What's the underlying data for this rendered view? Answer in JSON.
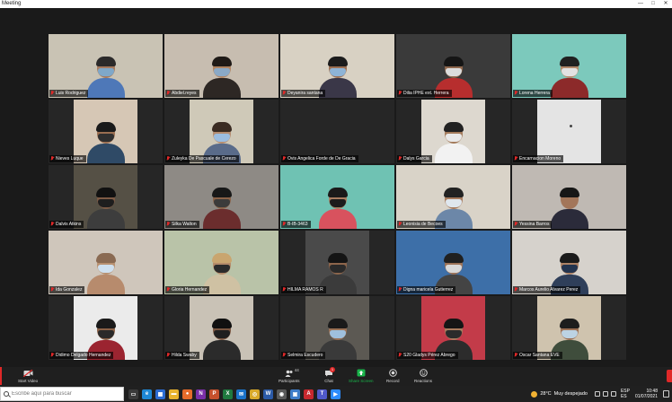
{
  "window": {
    "title": "Meeting",
    "controls": {
      "minimize": "—",
      "maximize": "□",
      "close": "✕"
    }
  },
  "participants": [
    {
      "name": "Luis Rodriguez",
      "bg": "#c9c3b4",
      "scene": "full",
      "skin": "#a67a5e",
      "mask": "#7fa8c9",
      "shirt": "#4e78b8",
      "hair": "#2b2a2a"
    },
    {
      "name": "Abdiel.reyes",
      "bg": "#c7bdb0",
      "scene": "full",
      "skin": "#b08462",
      "mask": "#8aa9c7",
      "shirt": "#2d2724",
      "hair": "#1f1a17"
    },
    {
      "name": "Deyanira santana",
      "bg": "#d8d1c3",
      "scene": "full",
      "skin": "#9c6f52",
      "mask": "#8eb4d6",
      "shirt": "#3a3748",
      "hair": "#1b1b1b"
    },
    {
      "name": "Dilia IPHE ext. Herrera",
      "bg": "#3a3a3a",
      "scene": "full",
      "skin": "#8d664c",
      "mask": "#dcdcdc",
      "shirt": "#b72e2e",
      "hair": "#151515"
    },
    {
      "name": "Lorena Herrera",
      "bg": "#7cc9bc",
      "scene": "full",
      "skin": "#b3886a",
      "mask": "#e2e2e2",
      "shirt": "#8c2a2a",
      "hair": "#202020"
    },
    {
      "name": "Nieves Luque",
      "bg": "#d6c7b5",
      "scene": "center",
      "skin": "#9a6e51",
      "mask": "#2f2f2f",
      "shirt": "#2f4a66",
      "hair": "#1a1a1a"
    },
    {
      "name": "Zuleyka De Pascuale de Cerezo",
      "bg": "#cfc9b8",
      "scene": "center",
      "skin": "#b48c70",
      "mask": "#9bbde0",
      "shirt": "#596b8a",
      "hair": "#3a2b22"
    },
    {
      "name": "Ovis Angelica Forde de De Gracia",
      "bg": "#262626",
      "scene": "none",
      "skin": "#000000",
      "mask": "#000000",
      "shirt": "#000000",
      "hair": "#000000"
    },
    {
      "name": "Dalys Garcia",
      "bg": "#ddd8cf",
      "scene": "center",
      "skin": "#a37a5b",
      "mask": "#e9e9e9",
      "shirt": "#f2f2f2",
      "hair": "#222222"
    },
    {
      "name": "Encarnacion Moreno",
      "bg": "#e4e4e4",
      "scene": "center",
      "skin": "#e4e4e4",
      "mask": "#e4e4e4",
      "shirt": "#e4e4e4",
      "hair": "#e4e4e4"
    },
    {
      "name": "Dalvis Atkins",
      "bg": "#555045",
      "scene": "center",
      "skin": "#7d5a45",
      "mask": "#1e1e1e",
      "shirt": "#3d3d3d",
      "hair": "#111111"
    },
    {
      "name": "Silka Walton",
      "bg": "#8e8a85",
      "scene": "full",
      "skin": "#8a6248",
      "mask": "#3b3b3b",
      "shirt": "#6b2d2d",
      "hair": "#181818"
    },
    {
      "name": "B-IB-3463",
      "bg": "#6fc2b3",
      "scene": "full",
      "skin": "#a87c60",
      "mask": "#1c1c1c",
      "shirt": "#d8525e",
      "hair": "#1a1a1a"
    },
    {
      "name": "Leonisia de Becoes",
      "bg": "#d9d3c8",
      "scene": "full",
      "skin": "#a67b5e",
      "mask": "#dfe7ee",
      "shirt": "#6c87a8",
      "hair": "#222222"
    },
    {
      "name": "Yessina Barros",
      "bg": "#bfb9b3",
      "scene": "full",
      "skin": "#a3765a",
      "mask": "#a3765a",
      "shirt": "#2b2b3a",
      "hair": "#161616"
    },
    {
      "name": "Ida Gonzalez",
      "bg": "#cfc6bb",
      "scene": "full",
      "skin": "#b89070",
      "mask": "#cfe0ef",
      "shirt": "#b78b6d",
      "hair": "#8a6a52"
    },
    {
      "name": "Gloria Hernandez",
      "bg": "#b9c3a8",
      "scene": "full",
      "skin": "#b48a69",
      "mask": "#2b2b2b",
      "shirt": "#cfc1a3",
      "hair": "#c9a56f"
    },
    {
      "name": "HILMA RAMOS R",
      "bg": "#4a4a4a",
      "scene": "center",
      "skin": "#8d654b",
      "mask": "#2a2a2a",
      "shirt": "#3b3b3b",
      "hair": "#141414"
    },
    {
      "name": "Digna maricela Gutierrez",
      "bg": "#3d6fa8",
      "scene": "full",
      "skin": "#9c7257",
      "mask": "#d9d9d9",
      "shirt": "#444444",
      "hair": "#202020"
    },
    {
      "name": "Marcos Aurelio Alvarez Perez",
      "bg": "#d6d2cc",
      "scene": "full",
      "skin": "#ad8265",
      "mask": "#23344f",
      "shirt": "#2f3f5a",
      "hair": "#1b1b1b"
    },
    {
      "name": "Didimo Delgado Hernandez",
      "bg": "#ebebeb",
      "scene": "center",
      "skin": "#8a6147",
      "mask": "#2a2a2a",
      "shirt": "#9b2430",
      "hair": "#1a1a1a"
    },
    {
      "name": "Hilda Swaby",
      "bg": "#c9c2b6",
      "scene": "center",
      "skin": "#7a5641",
      "mask": "#1f1f1f",
      "shirt": "#2b2b2b",
      "hair": "#101010"
    },
    {
      "name": "Selmira Escudero",
      "bg": "#5c5953",
      "scene": "center",
      "skin": "#9a7156",
      "mask": "#9fc0dd",
      "shirt": "#3a3a3a",
      "hair": "#1a1a1a"
    },
    {
      "name": "S20 Gladys Pérez Abrego",
      "bg": "#c33b49",
      "scene": "center",
      "skin": "#a87b5e",
      "mask": "#2b2b2b",
      "shirt": "#2c2c2c",
      "hair": "#151515"
    },
    {
      "name": "Oscar Santana EVE",
      "bg": "#cfc3ae",
      "scene": "center",
      "skin": "#9b7054",
      "mask": "#bcd3e3",
      "shirt": "#3f4d3c",
      "hair": "#1d1d1d"
    }
  ],
  "toolbar": {
    "start_video": "Start Video",
    "participants": "Participants",
    "participants_count": "44",
    "chat": "Chat",
    "chat_badge": "1",
    "share_screen": "Share Screen",
    "record": "Record",
    "reactions": "Reactions"
  },
  "taskbar": {
    "search_placeholder": "Escribe aquí para buscar",
    "weather_temp": "28°C",
    "weather_desc": "Muy despejado",
    "lang_top": "ESP",
    "lang_bottom": "ES",
    "time": "10:48",
    "date": "01/07/2021",
    "apps": [
      {
        "name": "task-view",
        "color": "#3a3a3a",
        "glyph": "▭"
      },
      {
        "name": "edge",
        "color": "#1e88d6",
        "glyph": "e"
      },
      {
        "name": "store",
        "color": "#2b6bd1",
        "glyph": "▦"
      },
      {
        "name": "files",
        "color": "#e8b32e",
        "glyph": "▬"
      },
      {
        "name": "firefox",
        "color": "#e66b2a",
        "glyph": "●"
      },
      {
        "name": "onenote",
        "color": "#7a2fa8",
        "glyph": "N"
      },
      {
        "name": "powerpoint",
        "color": "#c5502c",
        "glyph": "P"
      },
      {
        "name": "excel",
        "color": "#1f7a3f",
        "glyph": "X"
      },
      {
        "name": "mail",
        "color": "#1a73c9",
        "glyph": "✉"
      },
      {
        "name": "chrome",
        "color": "#d8a92a",
        "glyph": "◎"
      },
      {
        "name": "word",
        "color": "#2b5aa7",
        "glyph": "W"
      },
      {
        "name": "camera",
        "color": "#5a5a5a",
        "glyph": "◉"
      },
      {
        "name": "photos",
        "color": "#3e7dc9",
        "glyph": "▣"
      },
      {
        "name": "acrobat",
        "color": "#c8282e",
        "glyph": "A"
      },
      {
        "name": "teams",
        "color": "#5059c9",
        "glyph": "T"
      },
      {
        "name": "zoom",
        "color": "#2d8cff",
        "glyph": "▶"
      }
    ]
  }
}
